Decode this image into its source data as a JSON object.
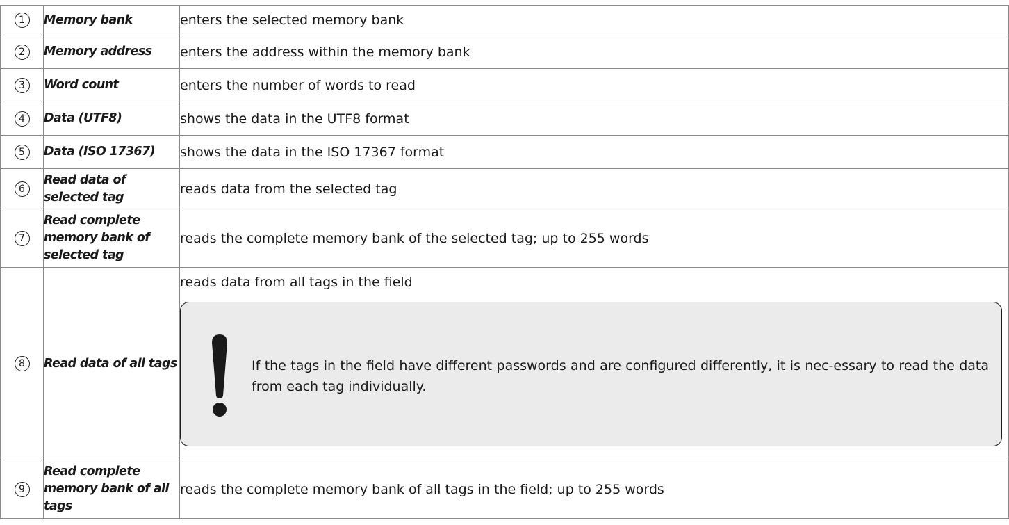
{
  "rows": [
    {
      "num": "1",
      "name": "Memory bank",
      "desc": "enters the selected memory bank"
    },
    {
      "num": "2",
      "name": "Memory address",
      "desc": "enters the address within the memory bank"
    },
    {
      "num": "3",
      "name": "Word count",
      "desc": "enters the number of words to read"
    },
    {
      "num": "4",
      "name": "Data (UTF8)",
      "desc": "shows the data in the UTF8 format"
    },
    {
      "num": "5",
      "name": "Data (ISO 17367)",
      "desc": "shows the data in the ISO 17367 format"
    },
    {
      "num": "6",
      "name": "Read data of selected tag",
      "desc": "reads data from the selected tag"
    },
    {
      "num": "7",
      "name": "Read complete memory bank of selected tag",
      "desc": "reads the complete memory bank of the selected tag; up to 255 words"
    },
    {
      "num": "8",
      "name": "Read data of all tags",
      "desc": "reads data from all tags in the field",
      "note": "If the tags in the field have different passwords and are configured differently, it is nec-essary to read the data from each tag individually."
    },
    {
      "num": "9",
      "name": "Read complete memory bank of all tags",
      "desc": "reads the complete memory bank of all tags in the field; up to 255 words"
    }
  ],
  "icons": {
    "note_icon": "exclamation-icon"
  },
  "colors": {
    "note_bg": "#ebebeb",
    "border": "#8c8c8c",
    "text": "#1a1a1a"
  }
}
